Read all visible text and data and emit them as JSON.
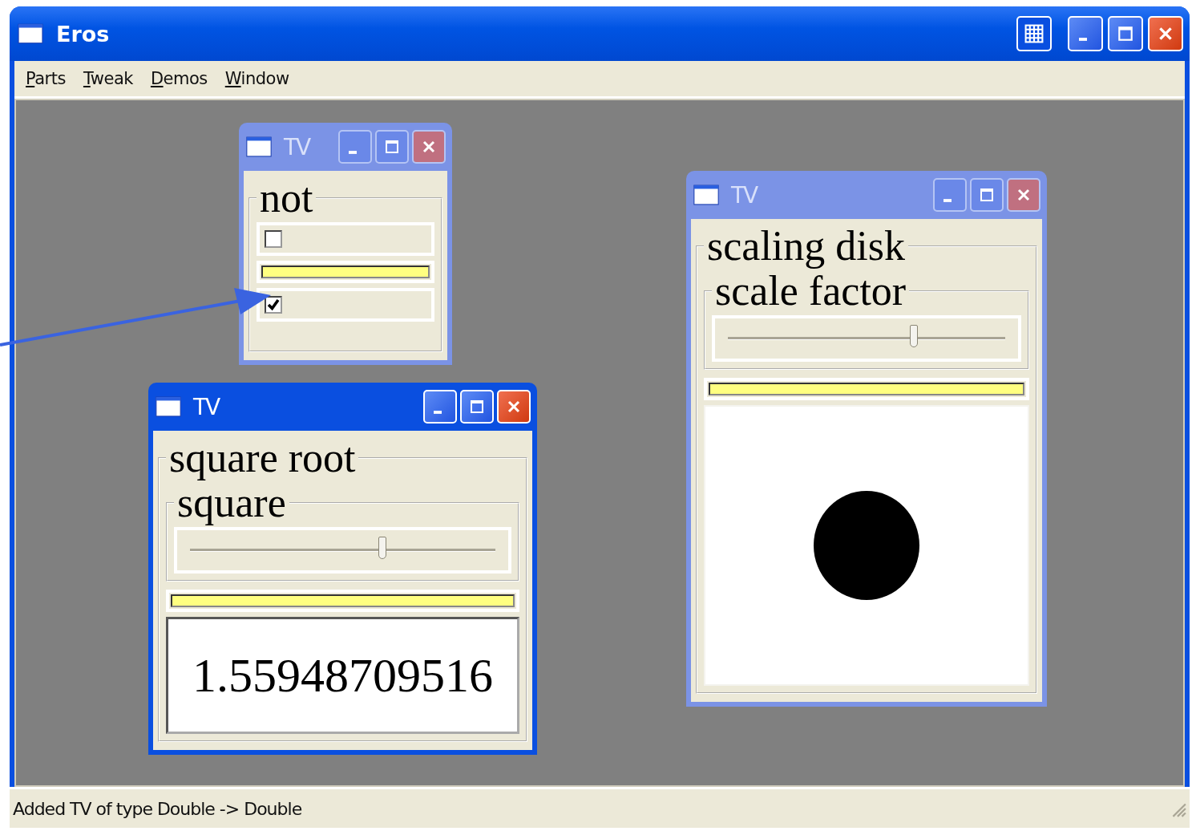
{
  "window": {
    "title": "Eros"
  },
  "menu": [
    {
      "mnemonic": "P",
      "rest": "arts"
    },
    {
      "mnemonic": "T",
      "rest": "weak"
    },
    {
      "mnemonic": "D",
      "rest": "emos"
    },
    {
      "mnemonic": "W",
      "rest": "indow"
    }
  ],
  "tvs": [
    {
      "title": "TV",
      "active": false,
      "label": "not",
      "rows": [
        {
          "kind": "checkbox",
          "checked": false
        },
        {
          "kind": "bar"
        },
        {
          "kind": "checkbox",
          "checked": true
        }
      ]
    },
    {
      "title": "TV",
      "active": true,
      "label": "square root",
      "inner": {
        "label": "square",
        "rows": [
          {
            "kind": "slider",
            "level": 0.63
          }
        ]
      },
      "rows": [
        {
          "kind": "bar"
        },
        {
          "kind": "number",
          "value": "1.55948709516"
        }
      ]
    },
    {
      "title": "TV",
      "active": false,
      "label": "scaling disk",
      "inner": {
        "label": "scale factor",
        "rows": [
          {
            "kind": "slider",
            "level": 0.67
          }
        ]
      },
      "rows": [
        {
          "kind": "bar"
        },
        {
          "kind": "disk"
        }
      ]
    }
  ],
  "status_bar": "Added TV of type Double -> Double"
}
